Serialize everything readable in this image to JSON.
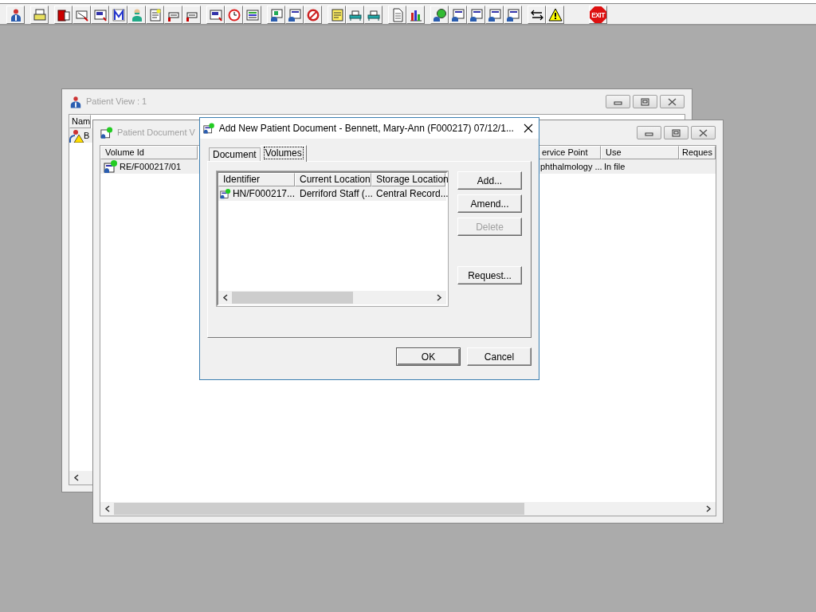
{
  "toolbar": {
    "exit_label": "EXIT"
  },
  "patient_view": {
    "title": "Patient View : 1",
    "columns": [
      "Nam"
    ],
    "rows": [
      {
        "selected": true,
        "cells": [
          "B"
        ]
      }
    ]
  },
  "document_window": {
    "title": "Patient Document V",
    "columns": [
      "Volume Id",
      "ervice Point",
      "Use",
      "Reques"
    ],
    "rows": [
      {
        "selected": true,
        "cells": [
          "RE/F000217/01",
          "phthalmology ...",
          "In file"
        ]
      }
    ]
  },
  "dialog": {
    "title": "Add New Patient Document - Bennett, Mary-Ann (F000217) 07/12/1...",
    "tabs": [
      {
        "label": "Document",
        "selected": false
      },
      {
        "label": "Volumes",
        "selected": true
      }
    ],
    "list": {
      "columns": [
        "Identifier",
        "Current Location",
        "Storage Location"
      ],
      "rows": [
        {
          "selected": true,
          "cells": [
            "HN/F000217...",
            "Derriford Staff (...",
            "Central Record..."
          ]
        }
      ]
    },
    "side_buttons": [
      {
        "label": "Add...",
        "disabled": false
      },
      {
        "label": "Amend...",
        "disabled": false
      },
      {
        "label": "Delete",
        "disabled": true
      },
      {
        "label": "Request...",
        "disabled": false
      }
    ],
    "buttons": [
      "OK",
      "Cancel"
    ]
  }
}
